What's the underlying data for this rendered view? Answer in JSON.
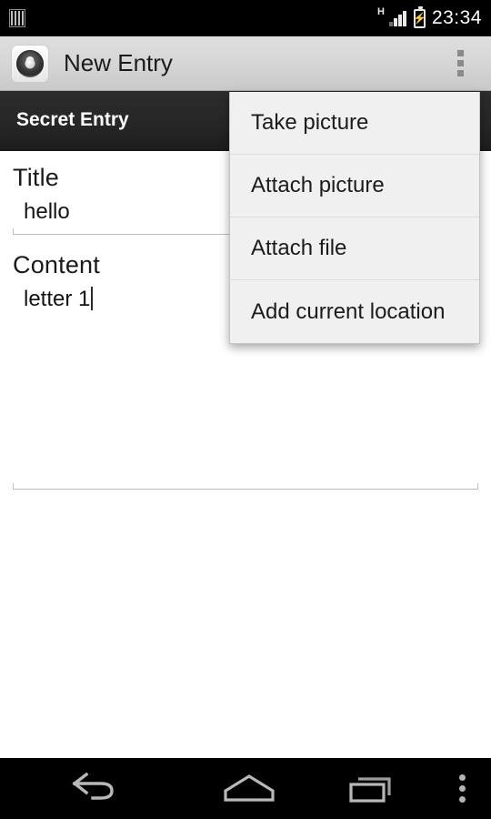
{
  "status_bar": {
    "left_icon": "sim-card-icon",
    "network_type": "H",
    "signal_icon": "signal-bars-icon",
    "battery_icon": "battery-charging-icon",
    "clock": "23:34"
  },
  "action_bar": {
    "app_icon": "safe-dial-icon",
    "title": "New Entry",
    "overflow_icon": "overflow-menu-icon"
  },
  "secret_bar": {
    "label": "Secret Entry"
  },
  "form": {
    "title_label": "Title",
    "title_value": "hello",
    "content_label": "Content",
    "content_value": "letter 1"
  },
  "popup_menu": {
    "items": [
      {
        "label": "Take picture"
      },
      {
        "label": "Attach picture"
      },
      {
        "label": "Attach file"
      },
      {
        "label": "Add current location"
      }
    ]
  },
  "nav_bar": {
    "back": "back-icon",
    "home": "home-icon",
    "recents": "recents-icon",
    "menu": "menu-dots-icon"
  },
  "colors": {
    "status_bar_bg": "#000000",
    "action_bar_bg": "#d6d6d6",
    "secret_bar_bg": "#262626",
    "menu_bg": "#f0f0f0",
    "text_primary": "#1a1a1a",
    "nav_bar_bg": "#000000"
  }
}
